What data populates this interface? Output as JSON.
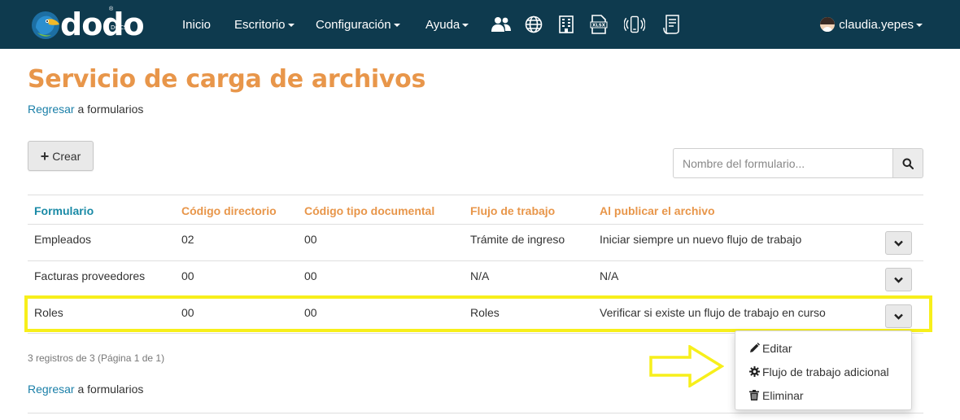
{
  "navbar": {
    "brand": "dodo",
    "brand_sub": "DOCS",
    "brand_reg": "®",
    "menu": [
      {
        "label": "Inicio",
        "has_caret": false
      },
      {
        "label": "Escritorio",
        "has_caret": true
      },
      {
        "label": "Configuración",
        "has_caret": true
      },
      {
        "label": "Ayuda",
        "has_caret": true
      }
    ],
    "icons": [
      "users-icon",
      "globe-icon",
      "building-icon",
      "xlsx-file-icon",
      "mobile-signal-icon",
      "document-list-icon"
    ],
    "user_name": "claudia.yepes"
  },
  "page": {
    "title": "Servicio de carga de archivos",
    "back_link": {
      "link_text": "Regresar",
      "rest_text": " a formularios"
    }
  },
  "toolbar": {
    "create_label": "Crear",
    "search_placeholder": "Nombre del formulario..."
  },
  "table": {
    "headers": [
      "Formulario",
      "Código directorio",
      "Código tipo documental",
      "Flujo de trabajo",
      "Al publicar el archivo"
    ],
    "rows": [
      [
        "Empleados",
        "02",
        "00",
        "Trámite de ingreso",
        "Iniciar siempre un nuevo flujo de trabajo"
      ],
      [
        "Facturas proveedores",
        "00",
        "00",
        "N/A",
        "N/A"
      ],
      [
        "Roles",
        "00",
        "00",
        "Roles",
        "Verificar si existe un flujo de trabajo en curso"
      ]
    ]
  },
  "footer": {
    "record_count": "3 registros de 3 (Página 1 de 1)"
  },
  "dropdown": {
    "items": [
      {
        "label": "Editar",
        "icon": "pencil-icon"
      },
      {
        "label": "Flujo de trabajo adicional",
        "icon": "gear-icon"
      },
      {
        "label": "Eliminar",
        "icon": "trash-icon"
      }
    ]
  },
  "colors": {
    "navbar": "#0e3a4e",
    "title": "#e8964a",
    "link": "#1a7fa8",
    "highlight": "#f7ef1b"
  }
}
